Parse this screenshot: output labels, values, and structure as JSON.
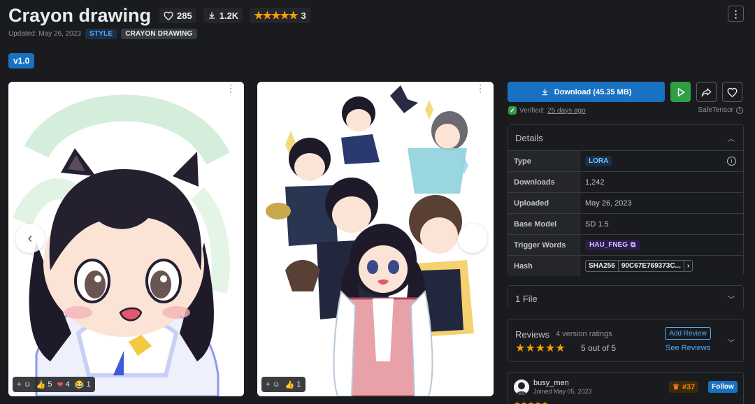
{
  "header": {
    "title": "Crayon drawing",
    "likes": "285",
    "downloads": "1.2K",
    "rating_stars": "★★★★★",
    "rating_count": "3",
    "updated": "Updated: May 26, 2023",
    "tags": [
      "STYLE",
      "CRAYON DRAWING"
    ]
  },
  "version": {
    "label": "v1.0"
  },
  "gallery": {
    "card1_reactions": {
      "thumbs": "5",
      "hearts": "4",
      "laugh": "1"
    },
    "card2_reactions": {
      "thumbs": "1"
    }
  },
  "actions": {
    "download_label": "Download (45.35 MB)",
    "verified_prefix": "Verified:",
    "verified_when": "25 days ago",
    "format": "SafeTensor"
  },
  "details": {
    "title": "Details",
    "rows": [
      {
        "key": "Type",
        "value": "LORA"
      },
      {
        "key": "Downloads",
        "value": "1,242"
      },
      {
        "key": "Uploaded",
        "value": "May 26, 2023"
      },
      {
        "key": "Base Model",
        "value": "SD 1.5"
      },
      {
        "key": "Trigger Words",
        "value": "HAU_FNEG"
      },
      {
        "key": "Hash",
        "value": "90C67E769373C...",
        "hash_type": "SHA256"
      }
    ]
  },
  "files": {
    "label": "1 File"
  },
  "reviews": {
    "title": "Reviews",
    "count": "4 version ratings",
    "stars": "★★★★★",
    "score": "5 out of 5",
    "add_label": "Add Review",
    "see_label": "See Reviews"
  },
  "creator": {
    "name": "busy_men",
    "joined": "Joined May 05, 2023",
    "rank": "#37",
    "follow_label": "Follow",
    "stars": "★★★★★"
  },
  "colors": {
    "accent": "#1971c2",
    "star": "#f59f00",
    "success": "#2f9e44"
  }
}
